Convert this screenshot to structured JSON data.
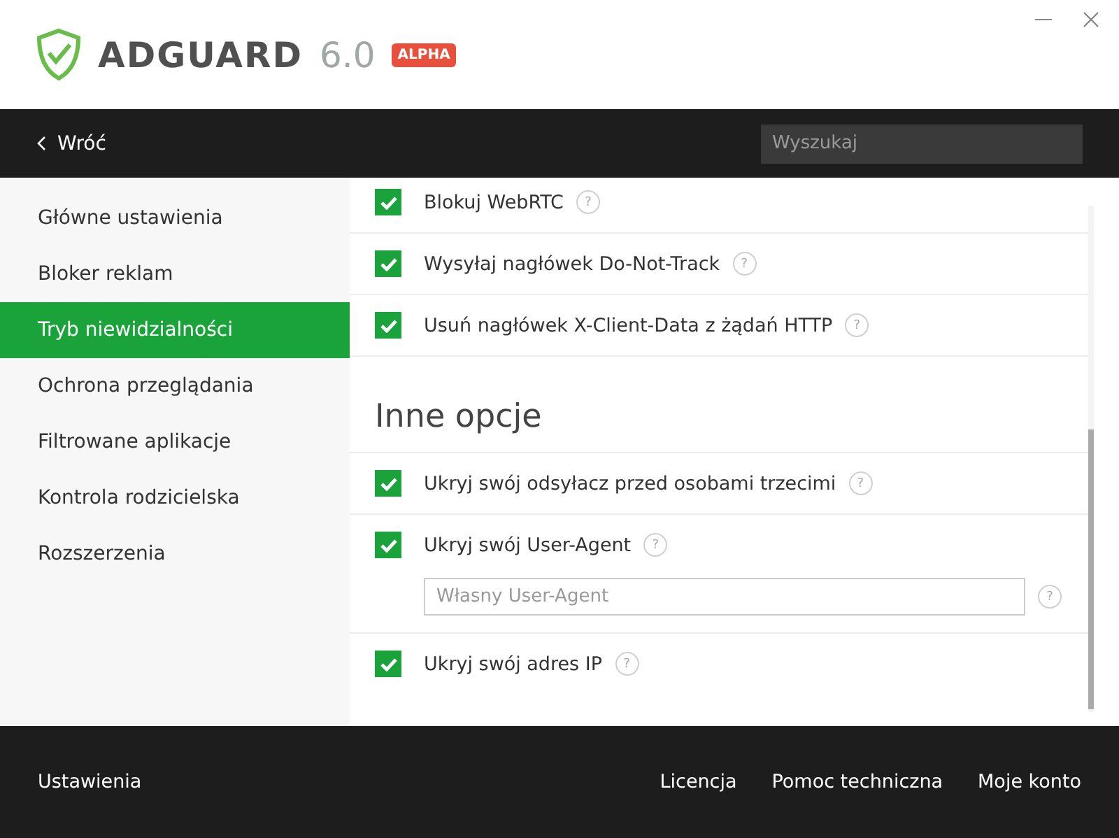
{
  "header": {
    "brand": "ADGUARD",
    "version": "6.0",
    "badge": "ALPHA"
  },
  "nav": {
    "back": "Wróć",
    "search": {
      "placeholder": "Wyszukaj"
    }
  },
  "sidebar": {
    "items": [
      {
        "label": "Główne ustawienia",
        "selected": false
      },
      {
        "label": "Bloker reklam",
        "selected": false
      },
      {
        "label": "Tryb niewidzialności",
        "selected": true
      },
      {
        "label": "Ochrona przeglądania",
        "selected": false
      },
      {
        "label": "Filtrowane aplikacje",
        "selected": false
      },
      {
        "label": "Kontrola rodzicielska",
        "selected": false
      },
      {
        "label": "Rozszerzenia",
        "selected": false
      }
    ]
  },
  "sections": [
    {
      "options": [
        {
          "label": "Blokuj WebRTC",
          "checked": true,
          "help": "?"
        },
        {
          "label": "Wysyłaj nagłówek Do-Not-Track",
          "checked": true,
          "help": "?"
        },
        {
          "label": "Usuń nagłówek X-Client-Data z żądań HTTP",
          "checked": true,
          "help": "?"
        }
      ]
    },
    {
      "title": "Inne opcje",
      "options": [
        {
          "label": "Ukryj swój odsyłacz przed osobami trzecimi",
          "checked": true,
          "help": "?"
        },
        {
          "label": "Ukryj swój User-Agent",
          "checked": true,
          "help": "?",
          "field": {
            "placeholder": "Własny User-Agent",
            "help": "?"
          }
        },
        {
          "label": "Ukryj swój adres IP",
          "checked": true,
          "help": "?"
        }
      ]
    }
  ],
  "footer": {
    "left": "Ustawienia",
    "links": [
      "Licencja",
      "Pomoc techniczna",
      "Moje konto"
    ]
  }
}
